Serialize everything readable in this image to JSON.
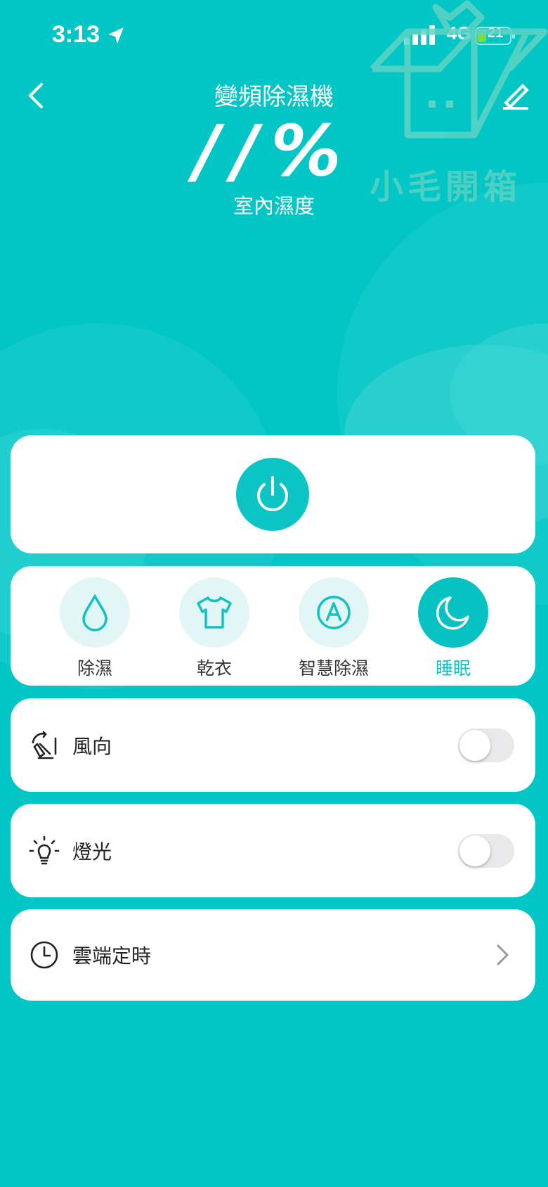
{
  "status_bar": {
    "time": "3:13",
    "network": "4G",
    "battery": "21"
  },
  "header": {
    "title": "變頻除濕機",
    "humidity_value": "//%",
    "humidity_label": "室內濕度"
  },
  "watermark": {
    "text": "小毛開箱"
  },
  "icons": {
    "back": "chevron-left-icon",
    "edit": "pencil-icon",
    "power": "power-icon"
  },
  "modes": [
    {
      "label": "除濕",
      "icon": "water-drop-icon",
      "active": false
    },
    {
      "label": "乾衣",
      "icon": "tshirt-icon",
      "active": false
    },
    {
      "label": "智慧除濕",
      "icon": "auto-a-icon",
      "active": false
    },
    {
      "label": "睡眠",
      "icon": "moon-icon",
      "active": true
    }
  ],
  "settings": {
    "wind_direction": {
      "label": "風向",
      "enabled": false
    },
    "light": {
      "label": "燈光",
      "enabled": false
    },
    "cloud_timer": {
      "label": "雲端定時"
    }
  },
  "colors": {
    "background": "#02c6c6",
    "accent": "#0cc4c4",
    "mode_inactive_bg": "#e2f7f5",
    "toggle_off": "#e9e9eb"
  }
}
